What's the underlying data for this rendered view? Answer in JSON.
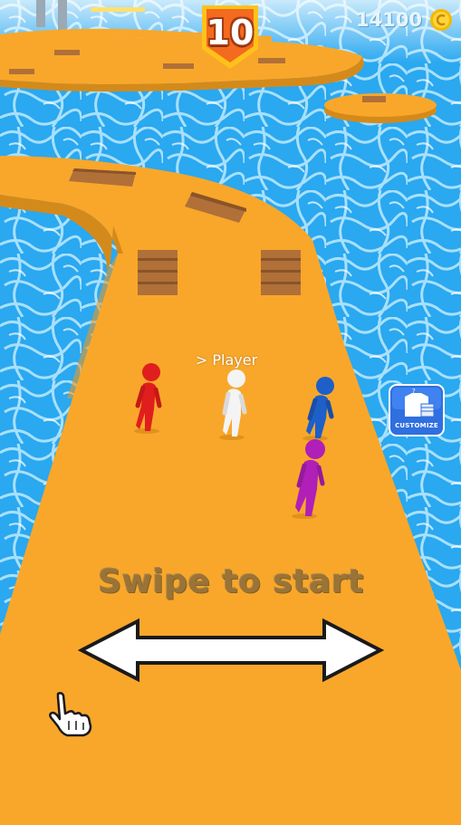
{
  "hud": {
    "level_number": "10",
    "coin_count": "14100",
    "coin_icon": "coin-icon"
  },
  "players": {
    "player_tag": "> Player",
    "runner_colors": [
      "#e01e1e",
      "#f4f4f4",
      "#1e5fc8",
      "#b01fb8"
    ]
  },
  "customize": {
    "label": "CUSTOMIZE",
    "icon": "shirt-icon"
  },
  "tutorial": {
    "prompt": "Swipe to start",
    "arrow_icon": "double-arrow-icon",
    "hand_icon": "pointing-hand-icon"
  },
  "colors": {
    "water": "#2aa8f0",
    "track": "#f9a72a",
    "track_edge": "#d48a1a",
    "plank": "#b07038",
    "badge_orange": "#f46a1e",
    "badge_gold": "#ffc21a"
  }
}
